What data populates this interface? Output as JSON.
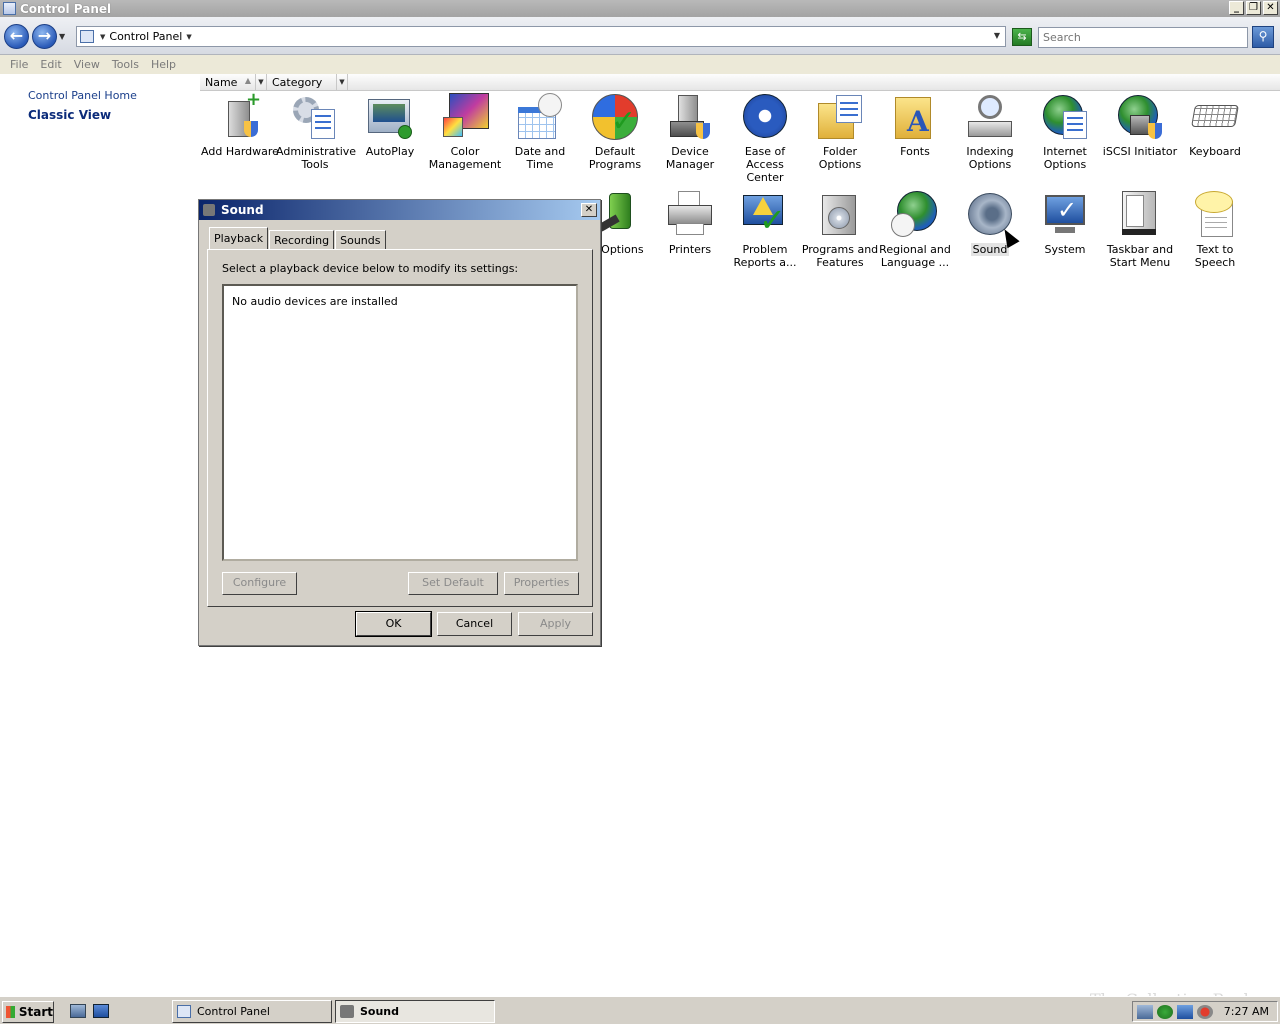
{
  "window": {
    "title": "Control Panel",
    "buttons": [
      "_",
      "❐",
      "✕"
    ]
  },
  "address": {
    "crumb": "Control Panel",
    "search_placeholder": "Search"
  },
  "menu": [
    "File",
    "Edit",
    "View",
    "Tools",
    "Help"
  ],
  "left_pane": {
    "home": "Control Panel Home",
    "classic": "Classic View"
  },
  "columns": {
    "name": "Name",
    "category": "Category"
  },
  "items": [
    {
      "label": "Add Hardware",
      "icon": "add-hardware-icon"
    },
    {
      "label": "Administrative Tools",
      "icon": "administrative-tools-icon"
    },
    {
      "label": "AutoPlay",
      "icon": "autoplay-icon"
    },
    {
      "label": "Color Management",
      "icon": "color-management-icon"
    },
    {
      "label": "Date and Time",
      "icon": "date-time-icon"
    },
    {
      "label": "Default Programs",
      "icon": "default-programs-icon"
    },
    {
      "label": "Device Manager",
      "icon": "device-manager-icon"
    },
    {
      "label": "Ease of Access Center",
      "icon": "ease-of-access-icon"
    },
    {
      "label": "Folder Options",
      "icon": "folder-options-icon"
    },
    {
      "label": "Fonts",
      "icon": "fonts-icon"
    },
    {
      "label": "Indexing Options",
      "icon": "indexing-options-icon"
    },
    {
      "label": "Internet Options",
      "icon": "internet-options-icon"
    },
    {
      "label": "iSCSI Initiator",
      "icon": "iscsi-initiator-icon"
    },
    {
      "label": "Keyboard",
      "icon": "keyboard-icon"
    },
    {
      "label": "er Options",
      "icon": "power-options-icon"
    },
    {
      "label": "Printers",
      "icon": "printers-icon"
    },
    {
      "label": "Problem Reports a...",
      "icon": "problem-reports-icon"
    },
    {
      "label": "Programs and Features",
      "icon": "programs-features-icon"
    },
    {
      "label": "Regional and Language ...",
      "icon": "regional-language-icon"
    },
    {
      "label": "Sound",
      "icon": "sound-icon"
    },
    {
      "label": "System",
      "icon": "system-icon"
    },
    {
      "label": "Taskbar and Start Menu",
      "icon": "taskbar-start-menu-icon"
    },
    {
      "label": "Text to Speech",
      "icon": "text-to-speech-icon"
    }
  ],
  "dialog": {
    "title": "Sound",
    "tabs": [
      "Playback",
      "Recording",
      "Sounds"
    ],
    "instruction": "Select a playback device below to modify its settings:",
    "empty_message": "No audio devices are installed",
    "panel_buttons": {
      "configure": "Configure",
      "set_default": "Set Default",
      "properties": "Properties"
    },
    "buttons": {
      "ok": "OK",
      "cancel": "Cancel",
      "apply": "Apply"
    }
  },
  "taskbar": {
    "start": "Start",
    "tasks": [
      "Control Panel",
      "Sound"
    ],
    "clock": "7:27 AM"
  },
  "watermark": "The Collection Book",
  "colors": {
    "title_gray": "#a3a3a3",
    "dialog_title": "#0a246a",
    "link": "#1b3f8b",
    "face": "#d4d0c8"
  }
}
